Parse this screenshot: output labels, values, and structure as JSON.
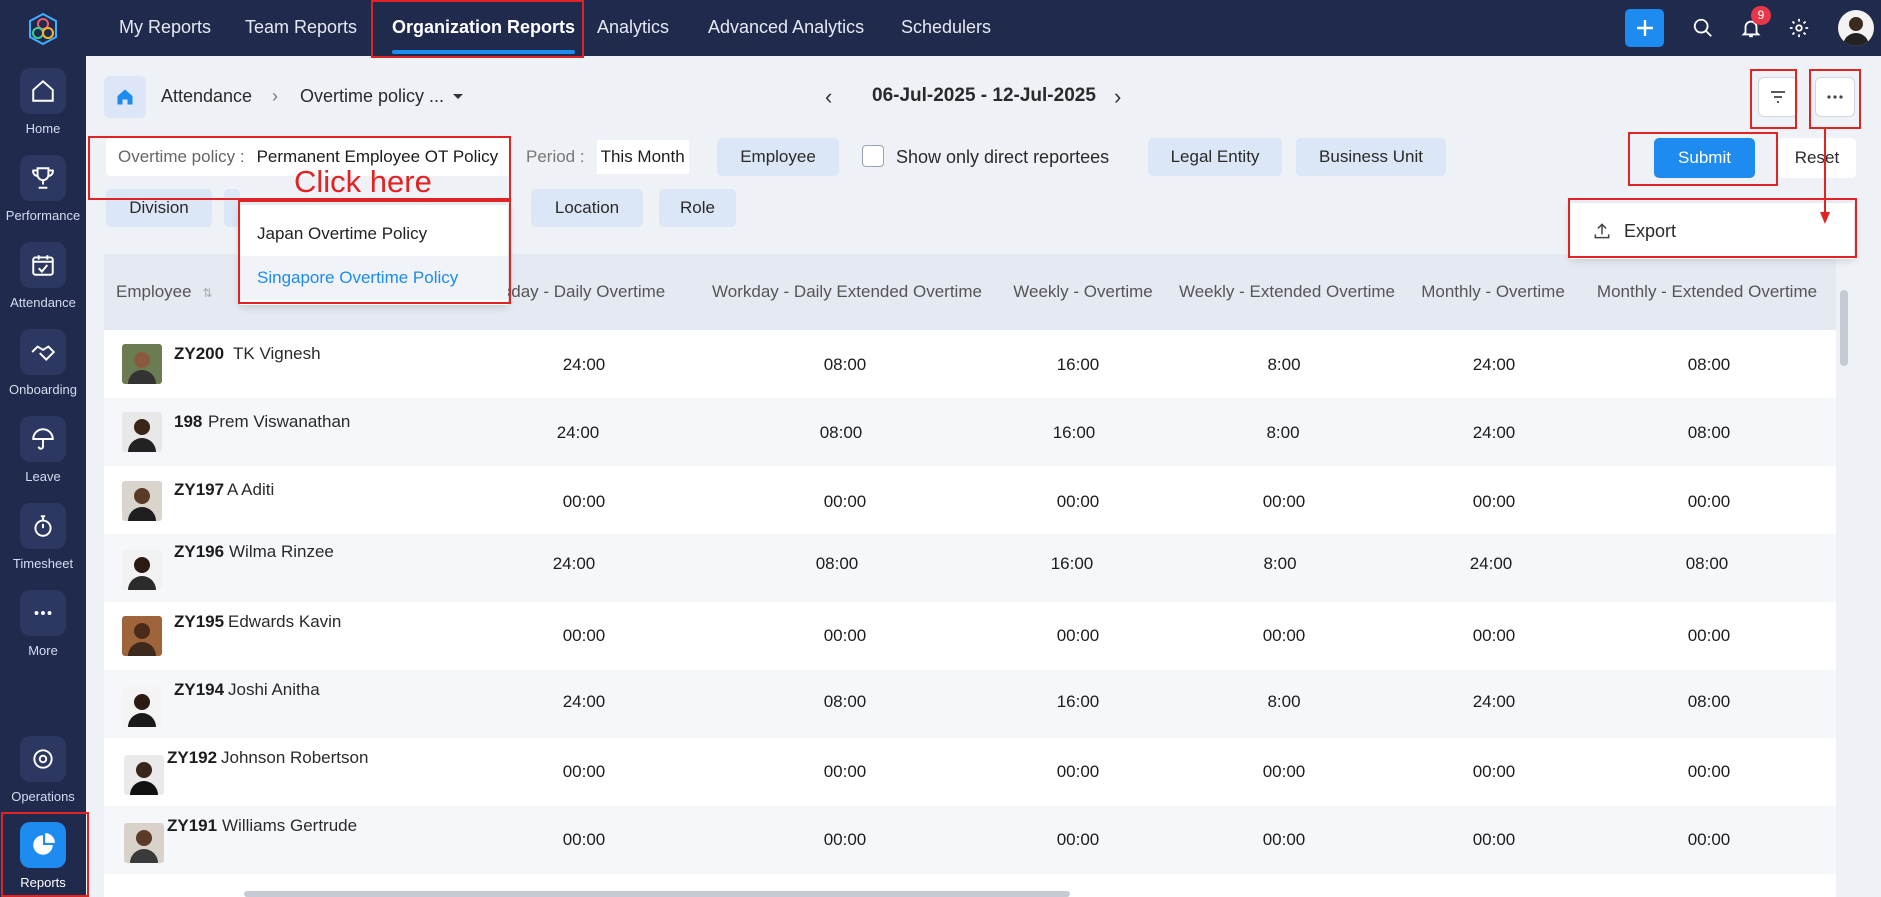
{
  "topnav": {
    "tabs": [
      {
        "label": "My Reports",
        "active": false
      },
      {
        "label": "Team Reports",
        "active": false
      },
      {
        "label": "Organization Reports",
        "active": true
      },
      {
        "label": "Analytics",
        "active": false
      },
      {
        "label": "Advanced Analytics",
        "active": false
      },
      {
        "label": "Schedulers",
        "active": false
      }
    ],
    "notification_count": "9"
  },
  "sidebar": {
    "items": [
      {
        "label": "Home",
        "icon": "home-icon"
      },
      {
        "label": "Performance",
        "icon": "trophy-icon"
      },
      {
        "label": "Attendance",
        "icon": "calendar-check-icon"
      },
      {
        "label": "Onboarding",
        "icon": "handshake-icon"
      },
      {
        "label": "Leave",
        "icon": "umbrella-icon"
      },
      {
        "label": "Timesheet",
        "icon": "stopwatch-icon"
      },
      {
        "label": "More",
        "icon": "more-dots-icon"
      },
      {
        "label": "Operations",
        "icon": "operations-icon"
      },
      {
        "label": "Reports",
        "icon": "pie-chart-icon"
      }
    ]
  },
  "breadcrumb": {
    "section": "Attendance",
    "report": "Overtime policy ..."
  },
  "date_range": "06-Jul-2025 - 12-Jul-2025",
  "filters": {
    "overtime_label": "Overtime policy :",
    "overtime_value": "Permanent Employee OT Policy",
    "period_label": "Period :",
    "period_value": "This Month",
    "employee": "Employee",
    "direct_reportees": "Show only direct reportees",
    "legal_entity": "Legal Entity",
    "business_unit": "Business Unit",
    "division": "Division",
    "location": "Location",
    "role": "Role",
    "submit": "Submit",
    "reset": "Reset"
  },
  "annotation": {
    "text": "Click here"
  },
  "dropdown": {
    "options": [
      {
        "label": "Japan Overtime Policy"
      },
      {
        "label": "Singapore Overtime Policy"
      }
    ]
  },
  "export_menu": {
    "label": "Export"
  },
  "table": {
    "columns": [
      "Employee",
      "kday - Daily Overtime",
      "Workday - Daily Extended Overtime",
      "Weekly - Overtime",
      "Weekly - Extended Overtime",
      "Monthly - Overtime",
      "Monthly - Extended Overtime"
    ],
    "rows": [
      {
        "id": "ZY200",
        "name": "TK Vignesh",
        "values": [
          "24:00",
          "08:00",
          "16:00",
          "8:00",
          "24:00",
          "08:00"
        ]
      },
      {
        "id": "198",
        "name": "Prem Viswanathan",
        "values": [
          "24:00",
          "08:00",
          "16:00",
          "8:00",
          "24:00",
          "08:00"
        ]
      },
      {
        "id": "ZY197",
        "name": "A Aditi",
        "values": [
          "00:00",
          "00:00",
          "00:00",
          "00:00",
          "00:00",
          "00:00"
        ]
      },
      {
        "id": "ZY196",
        "name": "Wilma Rinzee",
        "values": [
          "24:00",
          "08:00",
          "16:00",
          "8:00",
          "24:00",
          "08:00"
        ]
      },
      {
        "id": "ZY195",
        "name": "Edwards Kavin",
        "values": [
          "00:00",
          "00:00",
          "00:00",
          "00:00",
          "00:00",
          "00:00"
        ]
      },
      {
        "id": "ZY194",
        "name": "Joshi Anitha",
        "values": [
          "24:00",
          "08:00",
          "16:00",
          "8:00",
          "24:00",
          "08:00"
        ]
      },
      {
        "id": "ZY192",
        "name": "Johnson Robertson",
        "values": [
          "00:00",
          "00:00",
          "00:00",
          "00:00",
          "00:00",
          "00:00"
        ]
      },
      {
        "id": "ZY191",
        "name": "Williams Gertrude",
        "values": [
          "00:00",
          "00:00",
          "00:00",
          "00:00",
          "00:00",
          "00:00"
        ]
      }
    ]
  }
}
